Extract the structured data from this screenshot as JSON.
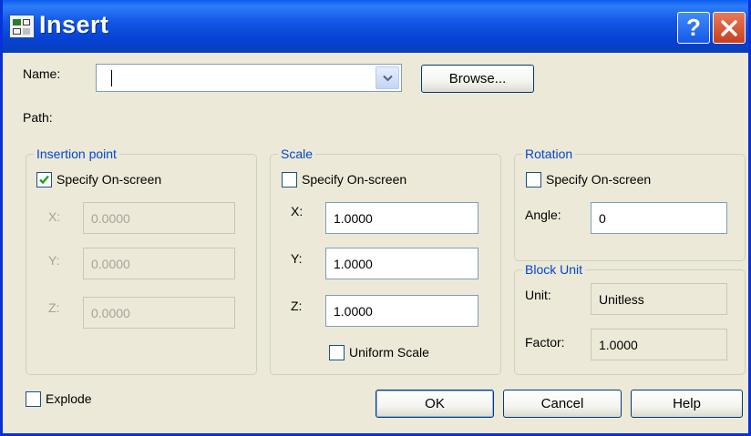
{
  "title": "Insert",
  "titlebar": {
    "help_glyph": "?",
    "icons": [
      "insert-block-icon",
      "help-icon",
      "close-icon"
    ]
  },
  "name": {
    "label": "Name:",
    "value": "",
    "browse_label": "Browse..."
  },
  "path": {
    "label": "Path:"
  },
  "insertion_point": {
    "legend": "Insertion point",
    "specify_label": "Specify On-screen",
    "specify_checked": true,
    "x_label": "X:",
    "x_value": "0.0000",
    "y_label": "Y:",
    "y_value": "0.0000",
    "z_label": "Z:",
    "z_value": "0.0000"
  },
  "scale": {
    "legend": "Scale",
    "specify_label": "Specify On-screen",
    "specify_checked": false,
    "x_label": "X:",
    "x_value": "1.0000",
    "y_label": "Y:",
    "y_value": "1.0000",
    "z_label": "Z:",
    "z_value": "1.0000",
    "uniform_label": "Uniform Scale",
    "uniform_checked": false
  },
  "rotation": {
    "legend": "Rotation",
    "specify_label": "Specify On-screen",
    "specify_checked": false,
    "angle_label": "Angle:",
    "angle_value": "0"
  },
  "block_unit": {
    "legend": "Block Unit",
    "unit_label": "Unit:",
    "unit_value": "Unitless",
    "factor_label": "Factor:",
    "factor_value": "1.0000"
  },
  "explode": {
    "label": "Explode",
    "checked": false
  },
  "buttons": {
    "ok": "OK",
    "cancel": "Cancel",
    "help": "Help"
  },
  "colors": {
    "title_bar": "#0a5ef0",
    "group_legend": "#0046d5",
    "dialog_bg": "#ece9d8",
    "checkmark": "#21a121",
    "close_button": "#e0512f"
  }
}
